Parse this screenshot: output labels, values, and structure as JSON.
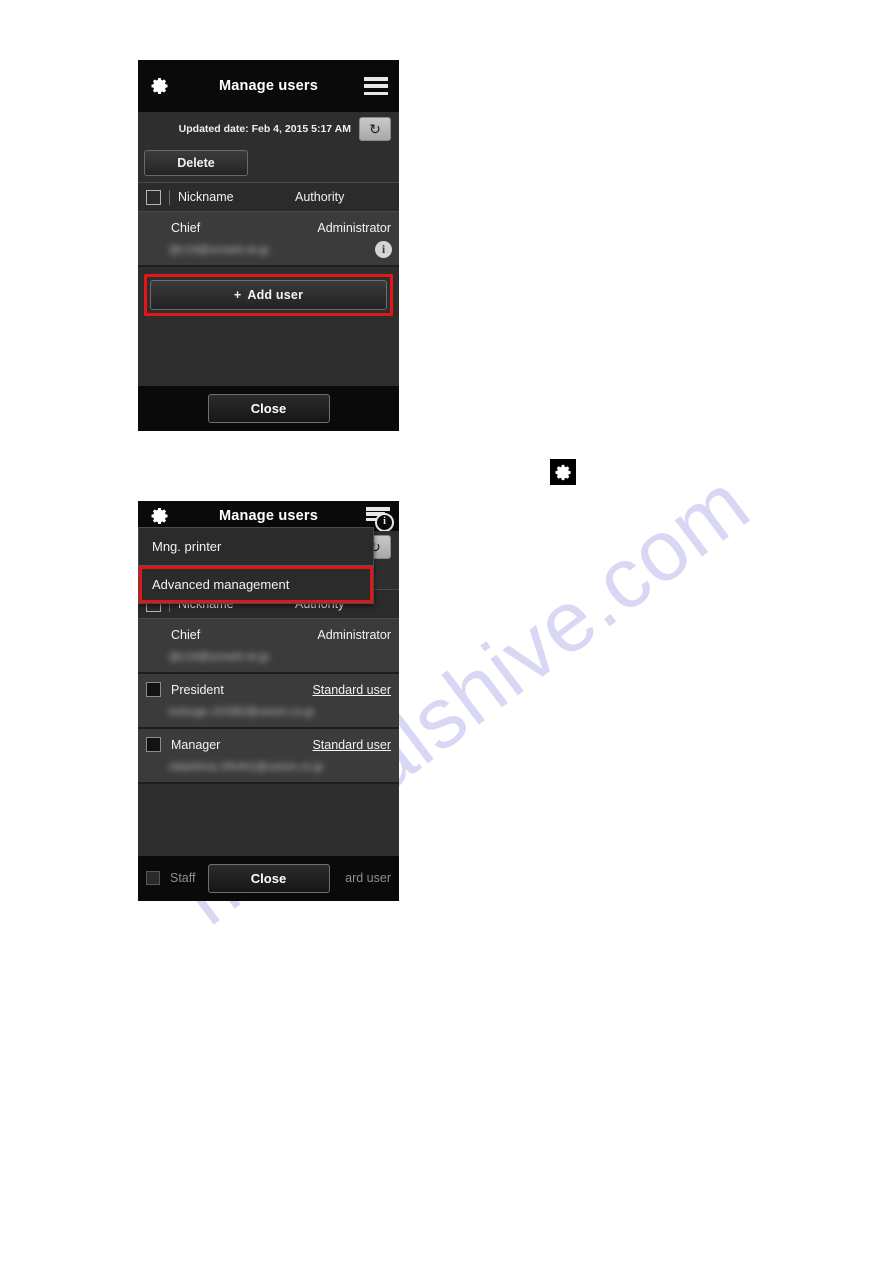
{
  "watermark": {
    "text": "manualshive.com"
  },
  "panel1": {
    "header": {
      "gear_icon": "gear-icon",
      "title": "Manage users",
      "menu_icon": "hamburger-menu-icon"
    },
    "updated_date": "Updated date: Feb 4, 2015 5:17 AM",
    "refresh_icon": "↻",
    "delete_label": "Delete",
    "list_header": {
      "nickname": "Nickname",
      "authority": "Authority"
    },
    "rows": [
      {
        "nickname": "Chief",
        "authority": "Administrator",
        "authority_is_link": false,
        "has_checkbox": false,
        "email": "@c19@screett.ne.jp",
        "info_icon": "info-icon"
      }
    ],
    "add_user_label": "Add user",
    "add_user_plus": "+",
    "close_label": "Close"
  },
  "panel2": {
    "header": {
      "gear_icon": "gear-icon",
      "title": "Manage users",
      "menu_icon": "hamburger-menu-info-icon",
      "info_badge": "i"
    },
    "dropdown": {
      "items": [
        {
          "label": "Mng. printer",
          "highlighted": false
        },
        {
          "label": "Advanced management",
          "highlighted": true
        }
      ]
    },
    "refresh_icon": "↻",
    "list_header": {
      "nickname": "Nickname",
      "authority": "Authority"
    },
    "rows": [
      {
        "nickname": "Chief",
        "authority": "Administrator",
        "authority_is_link": false,
        "has_checkbox": false,
        "email": "@c19@screett.ne.jp"
      },
      {
        "nickname": "President",
        "authority": "Standard user",
        "authority_is_link": true,
        "has_checkbox": true,
        "email": "kotsuge.J10382@canon.co.jp"
      },
      {
        "nickname": "Manager",
        "authority": "Standard user",
        "authority_is_link": true,
        "has_checkbox": true,
        "email": "odashima.J0h401@canon.co.jp"
      }
    ],
    "ghost_row": {
      "nickname": "Staff",
      "authority": "ard user"
    },
    "close_label": "Close"
  },
  "inline_gear": {
    "icon": "gear-icon"
  },
  "colors": {
    "highlight_red": "#e11616",
    "panel_bg": "#000000",
    "body_bg": "#2e2e2e",
    "row_bg": "#3b3b3b",
    "watermark": "#ccccf2"
  }
}
